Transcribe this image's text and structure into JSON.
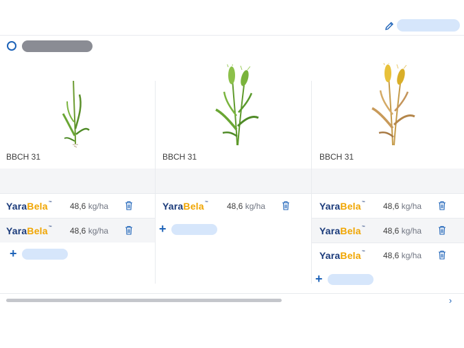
{
  "header": {
    "edit_icon": "pencil-icon"
  },
  "stage_selector": {
    "radio_icon": "radio-circle-icon"
  },
  "columns": [
    {
      "bbch": "BBCH 31",
      "plant_icon": "young-wheat-plant-icon",
      "products": [
        {
          "brand_part1": "Yara",
          "brand_part2": "Bela",
          "tm": "™",
          "amount": "48,6",
          "unit": "kg/ha"
        },
        {
          "brand_part1": "Yara",
          "brand_part2": "Bela",
          "tm": "™",
          "amount": "48,6",
          "unit": "kg/ha"
        }
      ]
    },
    {
      "bbch": "BBCH 31",
      "plant_icon": "green-wheat-ear-icon",
      "products": [
        {
          "brand_part1": "Yara",
          "brand_part2": "Bela",
          "tm": "™",
          "amount": "48,6",
          "unit": "kg/ha"
        }
      ]
    },
    {
      "bbch": "BBCH 31",
      "plant_icon": "ripe-wheat-ear-icon",
      "products": [
        {
          "brand_part1": "Yara",
          "brand_part2": "Bela",
          "tm": "™",
          "amount": "48,6",
          "unit": "kg/ha"
        },
        {
          "brand_part1": "Yara",
          "brand_part2": "Bela",
          "tm": "™",
          "amount": "48,6",
          "unit": "kg/ha"
        },
        {
          "brand_part1": "Yara",
          "brand_part2": "Bela",
          "tm": "™",
          "amount": "48,6",
          "unit": "kg/ha"
        }
      ]
    }
  ],
  "add_button": {
    "symbol": "+"
  },
  "scroll": {
    "right_icon": "chevron-right-icon",
    "symbol": "›"
  },
  "colors": {
    "accent": "#1c62b8",
    "brand_blue": "#1a3a7a",
    "brand_yellow": "#f0a500"
  }
}
